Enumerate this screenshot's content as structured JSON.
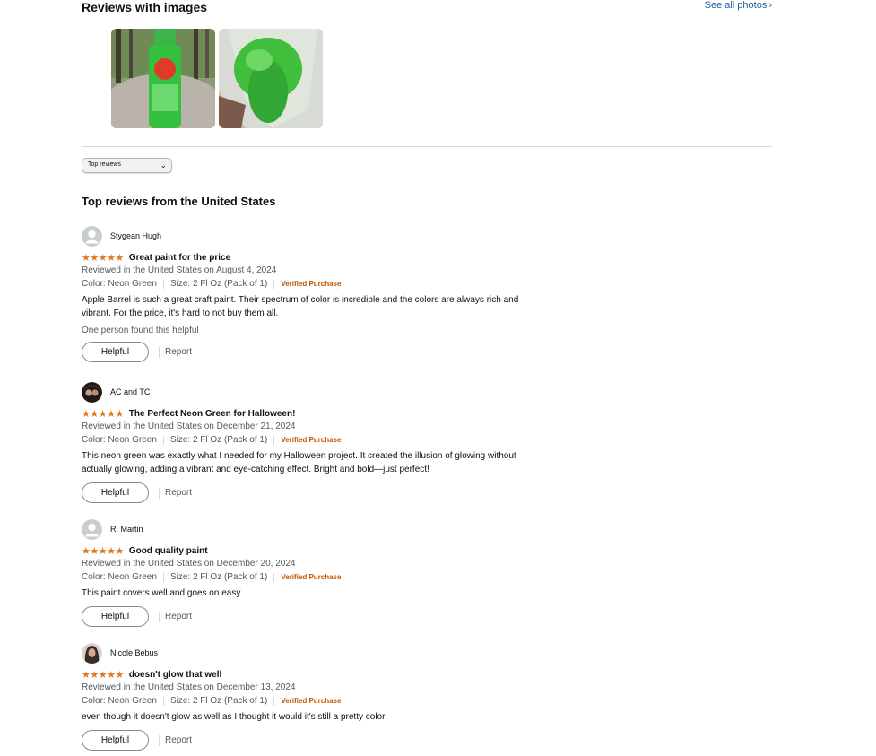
{
  "images_section": {
    "title": "Reviews with images",
    "see_all": "See all photos",
    "thumbnails": [
      {
        "icon": "paint-bottle-photo"
      },
      {
        "icon": "paint-bag-photo"
      }
    ]
  },
  "sort": {
    "selected": "Top reviews"
  },
  "section_title": "Top reviews from the United States",
  "colors": {
    "star": "#de7921",
    "verified": "#c45500",
    "link": "#2162a1"
  },
  "reviews": [
    {
      "name": "Stygean Hugh",
      "stars": "★★★★★",
      "title": "Great paint for the price",
      "date": "Reviewed in the United States on August 4, 2024",
      "color": "Color: Neon Green",
      "size": "Size: 2 Fl Oz (Pack of 1)",
      "verified": "Verified Purchase",
      "body": "Apple Barrel is such a great craft paint. Their spectrum of color is incredible and the colors are always rich and vibrant. For the price, it's hard to not buy them all.",
      "helpful_count": "One person found this helpful",
      "helpful": "Helpful",
      "report": "Report"
    },
    {
      "name": "AC and TC",
      "stars": "★★★★★",
      "title": "The Perfect Neon Green for Halloween!",
      "date": "Reviewed in the United States on December 21, 2024",
      "color": "Color: Neon Green",
      "size": "Size: 2 Fl Oz (Pack of 1)",
      "verified": "Verified Purchase",
      "body": "This neon green was exactly what I needed for my Halloween project. It created the illusion of glowing without actually glowing, adding a vibrant and eye-catching effect. Bright and bold—just perfect!",
      "helpful": "Helpful",
      "report": "Report"
    },
    {
      "name": "R. Martin",
      "stars": "★★★★★",
      "title": "Good quality paint",
      "date": "Reviewed in the United States on December 20, 2024",
      "color": "Color: Neon Green",
      "size": "Size: 2 Fl Oz (Pack of 1)",
      "verified": "Verified Purchase",
      "body": "This paint covers well and goes on easy",
      "helpful": "Helpful",
      "report": "Report"
    },
    {
      "name": "Nicole Bebus",
      "stars": "★★★★★",
      "title": "doesn't glow that well",
      "date": "Reviewed in the United States on December 13, 2024",
      "color": "Color: Neon Green",
      "size": "Size: 2 Fl Oz (Pack of 1)",
      "verified": "Verified Purchase",
      "body": "even though it doesn't glow as well as I thought it would it's still a pretty color",
      "helpful": "Helpful",
      "report": "Report"
    }
  ]
}
